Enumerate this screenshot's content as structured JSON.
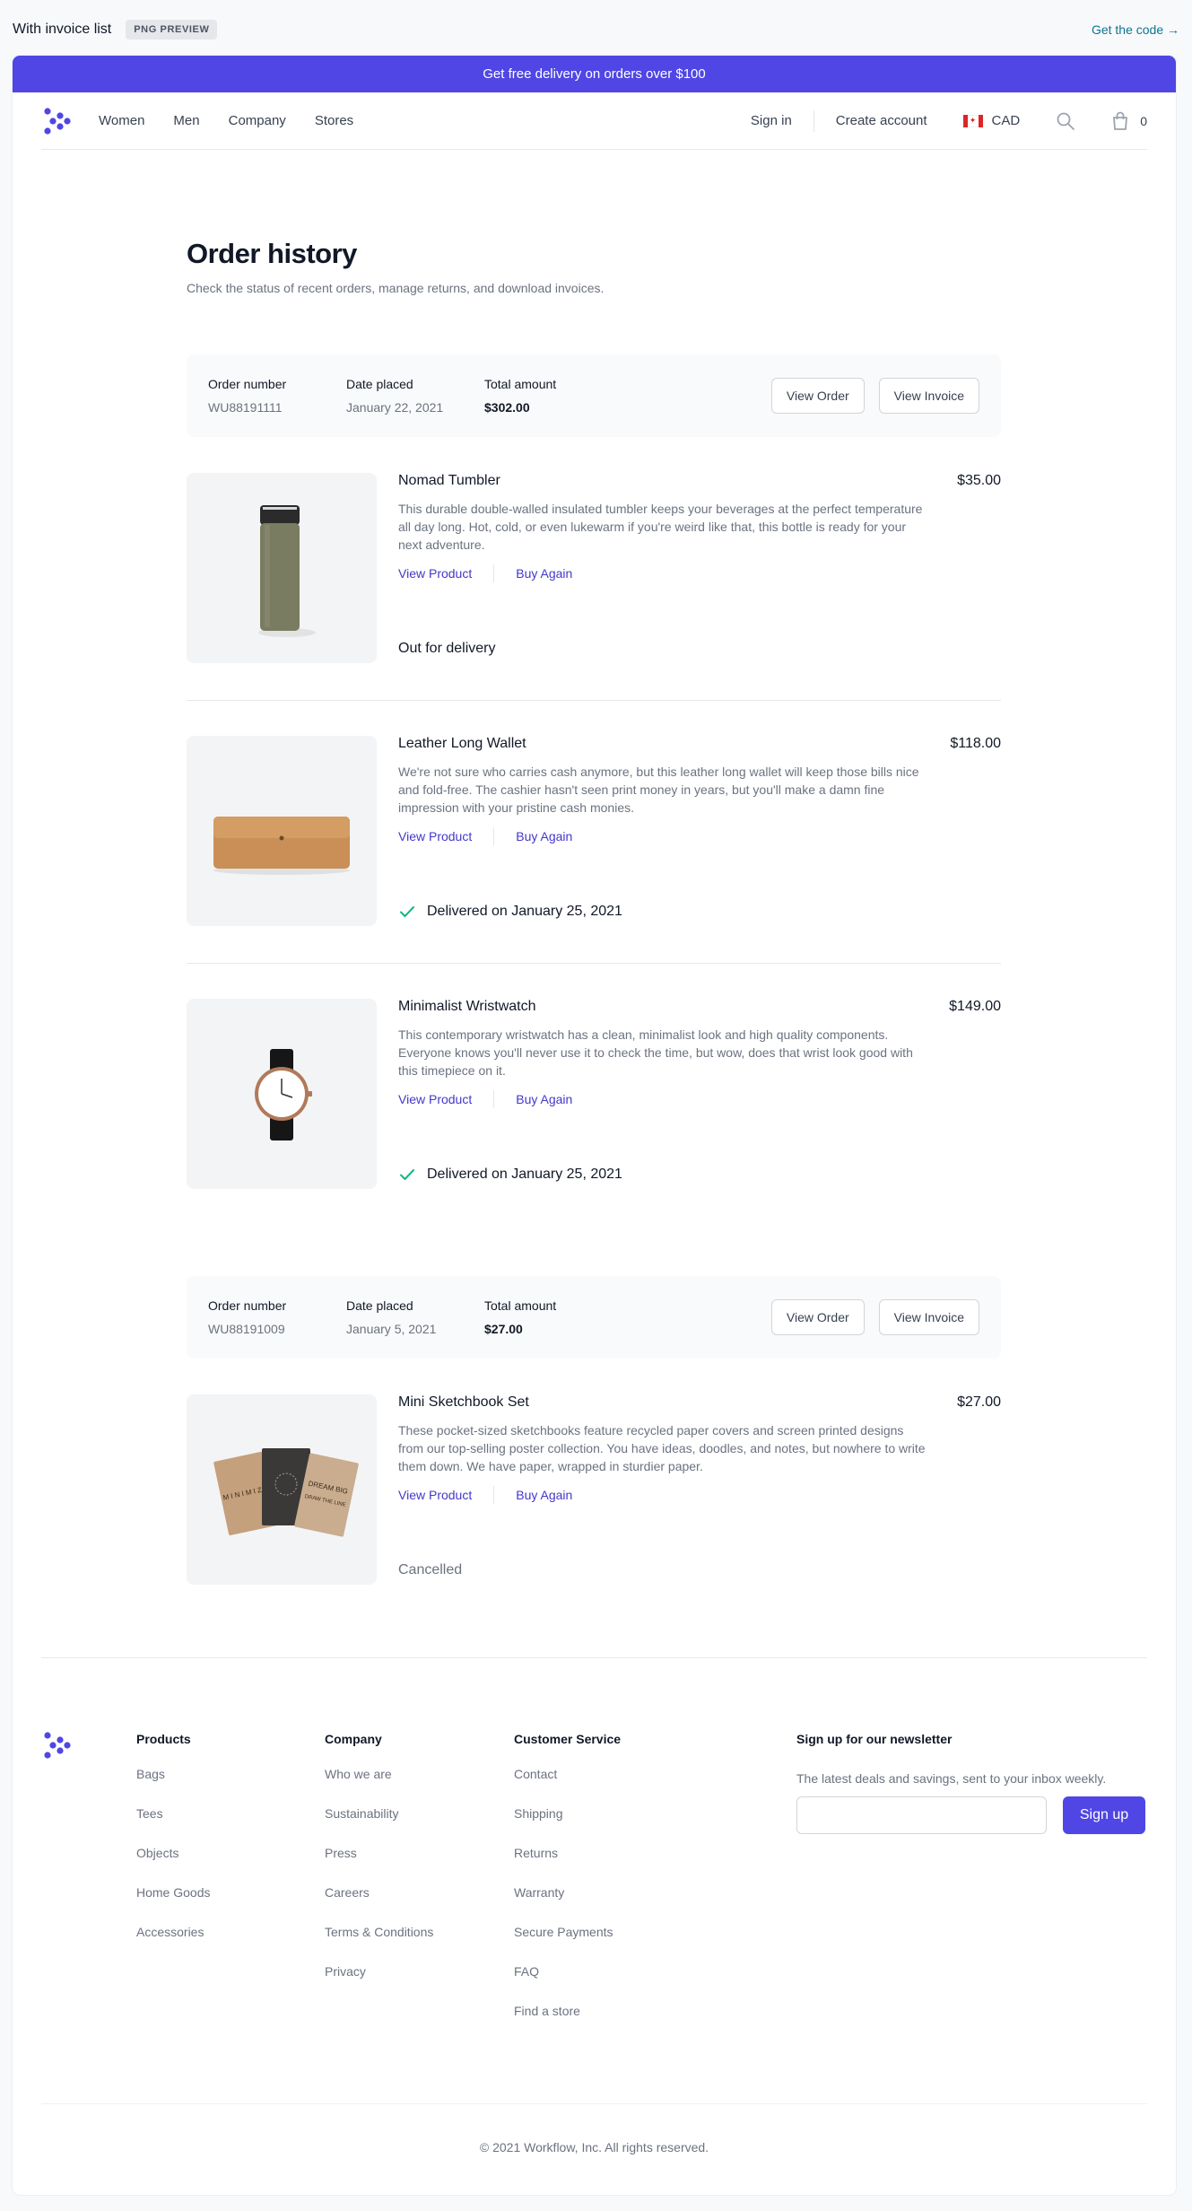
{
  "preview": {
    "title": "With invoice list",
    "badge": "PNG PREVIEW",
    "get_code": "Get the code →"
  },
  "promo": "Get free delivery on orders over $100",
  "nav": {
    "links": [
      "Women",
      "Men",
      "Company",
      "Stores"
    ],
    "sign_in": "Sign in",
    "create_account": "Create account",
    "currency": "CAD",
    "cart_count": "0",
    "icons": [
      "logo-icon",
      "canada-flag-icon",
      "search-icon",
      "shopping-bag-icon"
    ]
  },
  "page": {
    "title": "Order history",
    "subtitle": "Check the status of recent orders, manage returns, and download invoices."
  },
  "labels": {
    "order_number": "Order number",
    "date_placed": "Date placed",
    "total_amount": "Total amount",
    "view_order": "View Order",
    "view_invoice": "View Invoice",
    "view_product": "View Product",
    "buy_again": "Buy Again"
  },
  "orders": [
    {
      "number": "WU88191111",
      "date": "January 22, 2021",
      "total": "$302.00",
      "items": [
        {
          "name": "Nomad Tumbler",
          "price": "$35.00",
          "description": "This durable double-walled insulated tumbler keeps your beverages at the perfect temperature all day long. Hot, cold, or even lukewarm if you're weird like that, this bottle is ready for your next adventure.",
          "status": "Out for delivery",
          "status_icon": "none"
        },
        {
          "name": "Leather Long Wallet",
          "price": "$118.00",
          "description": "We're not sure who carries cash anymore, but this leather long wallet will keep those bills nice and fold-free. The cashier hasn't seen print money in years, but you'll make a damn fine impression with your pristine cash monies.",
          "status": "Delivered on January 25, 2021",
          "status_icon": "check-icon"
        },
        {
          "name": "Minimalist Wristwatch",
          "price": "$149.00",
          "description": "This contemporary wristwatch has a clean, minimalist look and high quality components. Everyone knows you'll never use it to check the time, but wow, does that wrist look good with this timepiece on it.",
          "status": "Delivered on January 25, 2021",
          "status_icon": "check-icon"
        }
      ]
    },
    {
      "number": "WU88191009",
      "date": "January 5, 2021",
      "total": "$27.00",
      "items": [
        {
          "name": "Mini Sketchbook Set",
          "price": "$27.00",
          "description": "These pocket-sized sketchbooks feature recycled paper covers and screen printed designs from our top-selling poster collection. You have ideas, doodles, and notes, but nowhere to write them down. We have paper, wrapped in sturdier paper.",
          "status": "Cancelled",
          "status_icon": "none",
          "sketchbook_covers": [
            "M I N I M I Z E",
            "DREAM BIG",
            "DRAW THE LINE"
          ]
        }
      ]
    }
  ],
  "footer": {
    "columns": [
      {
        "title": "Products",
        "links": [
          "Bags",
          "Tees",
          "Objects",
          "Home Goods",
          "Accessories"
        ]
      },
      {
        "title": "Company",
        "links": [
          "Who we are",
          "Sustainability",
          "Press",
          "Careers",
          "Terms & Conditions",
          "Privacy"
        ]
      },
      {
        "title": "Customer Service",
        "links": [
          "Contact",
          "Shipping",
          "Returns",
          "Warranty",
          "Secure Payments",
          "FAQ",
          "Find a store"
        ]
      }
    ],
    "newsletter": {
      "title": "Sign up for our newsletter",
      "text": "The latest deals and savings, sent to your inbox weekly.",
      "button": "Sign up",
      "input_value": ""
    },
    "copyright": "© 2021 Workflow, Inc. All rights reserved."
  },
  "colors": {
    "brand": "#4f46e5",
    "link": "#4338ca",
    "success": "#10b981",
    "get_code": "#0e7490"
  }
}
